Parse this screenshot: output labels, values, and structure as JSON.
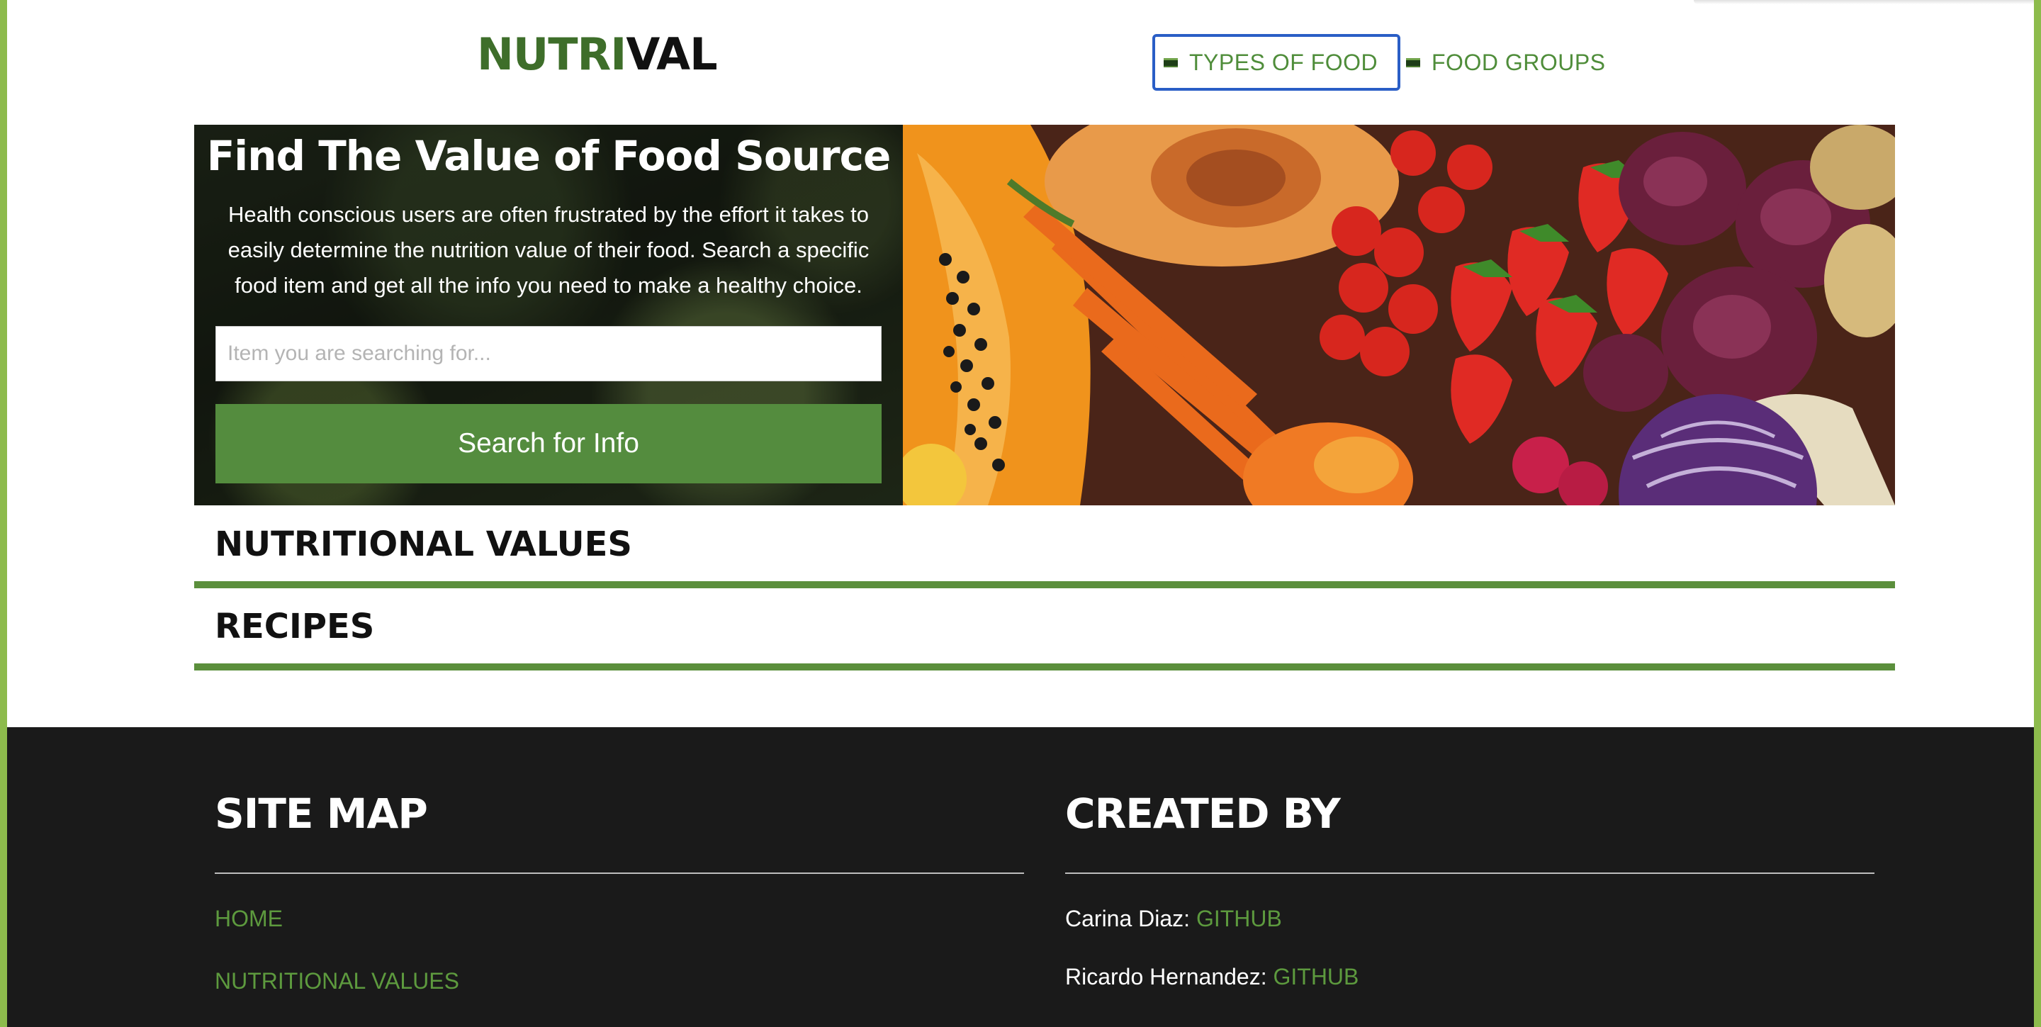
{
  "brand": {
    "logo_part1": "NUTRI",
    "logo_part2": "VAL"
  },
  "nav": {
    "types_of_food": "TYPES OF FOOD",
    "food_groups": "FOOD GROUPS"
  },
  "hero": {
    "title": "Find The Value of Food Source",
    "description": "Health conscious users are often frustrated by the effort it takes to easily determine the nutrition value of their food. Search a specific food item and get all the info you need to make a healthy choice.",
    "search_placeholder": "Item you are searching for...",
    "search_value": "",
    "search_button": "Search for Info",
    "image": "vegetables-fruits-photo"
  },
  "sections": {
    "nutritional_values": "NUTRITIONAL VALUES",
    "recipes": "RECIPES"
  },
  "footer": {
    "site_map_title": "SITE MAP",
    "site_map_links": [
      "HOME",
      "NUTRITIONAL VALUES"
    ],
    "created_by_title": "CREATED BY",
    "creators": [
      {
        "name": "Carina Diaz:",
        "link": "GITHUB"
      },
      {
        "name": "Ricardo Hernandez:",
        "link": "GITHUB"
      }
    ]
  },
  "colors": {
    "accent_green": "#548c3e",
    "logo_green": "#3e6e2a",
    "frame_green": "#8dbb4c",
    "footer_bg": "#1a1a1a",
    "focus_blue": "#2a5ec6"
  }
}
